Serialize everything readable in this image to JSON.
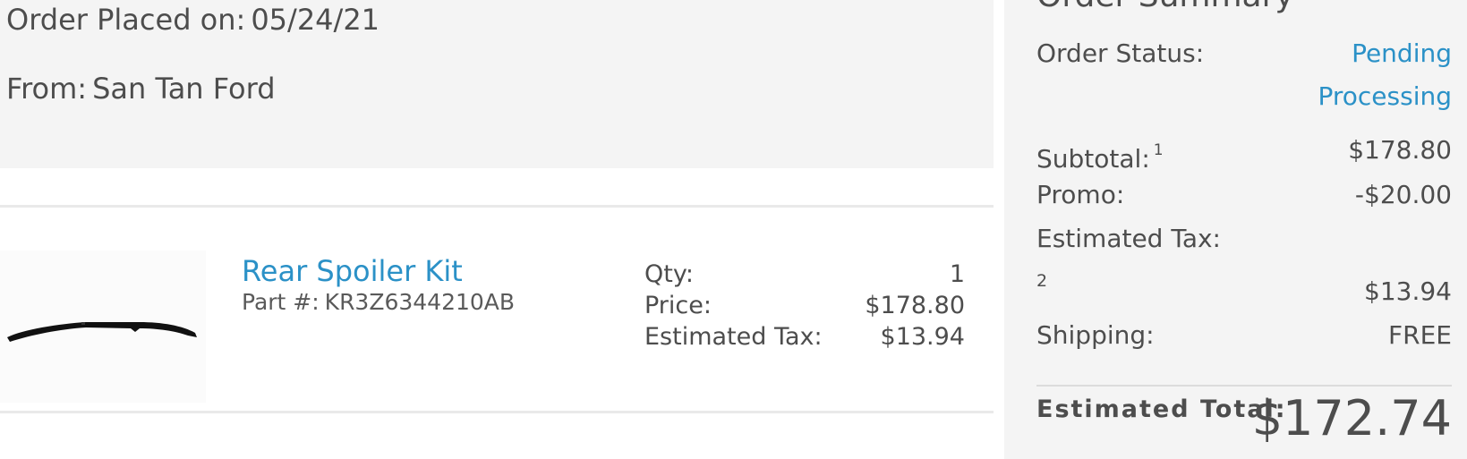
{
  "order": {
    "placed_label": "Order Placed on:",
    "placed_date": "05/24/21",
    "from_label": "From:",
    "from_dealer": "San Tan Ford"
  },
  "item": {
    "name": "Rear Spoiler Kit",
    "part_label": "Part #:",
    "part_number": "KR3Z6344210AB",
    "image_icon": "rear-spoiler-image",
    "details": [
      {
        "label": "Qty:",
        "value": "1"
      },
      {
        "label": "Price:",
        "value": "$178.80"
      },
      {
        "label": "Estimated Tax:",
        "value": "$13.94"
      }
    ]
  },
  "summary": {
    "title": "Order Summary",
    "status_label": "Order Status:",
    "status_value": "Pending Processing",
    "subtotal_label": "Subtotal:",
    "subtotal_footnote": "1",
    "subtotal_value": "$178.80",
    "promo_label": "Promo:",
    "promo_value": "-$20.00",
    "tax_label": "Estimated Tax:",
    "tax_footnote": "2",
    "tax_value": "$13.94",
    "shipping_label": "Shipping:",
    "shipping_value": "FREE",
    "total_label": "Estimated Total:",
    "total_value": "$172.74"
  },
  "colors": {
    "link": "#2b91c7",
    "text": "#4d4d4d",
    "panel_bg": "#f4f4f4"
  }
}
